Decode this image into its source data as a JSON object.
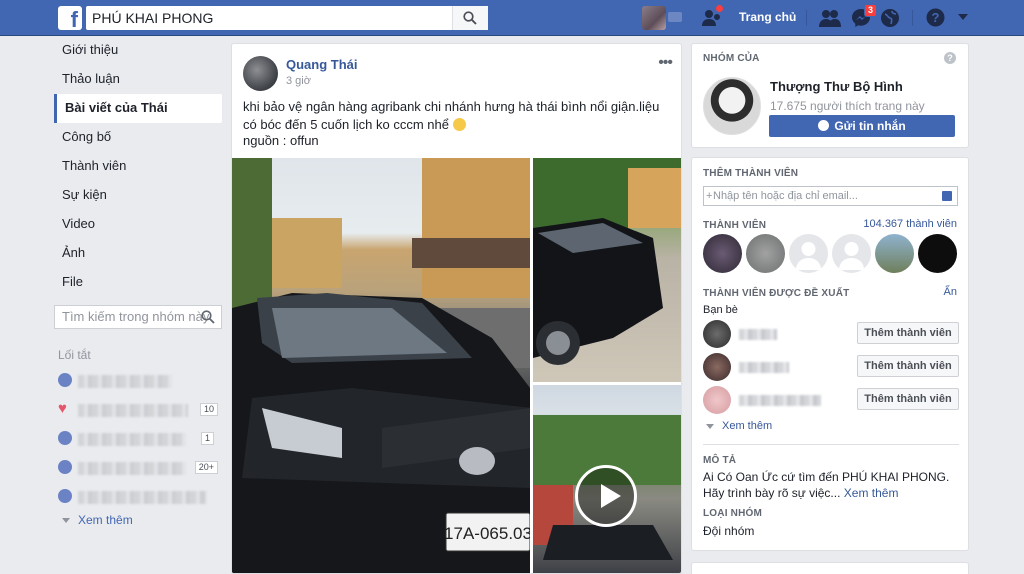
{
  "topbar": {
    "search_value": "PHÚ KHAI PHONG",
    "home_label": "Trang chủ",
    "messages_badge": "3",
    "colors": {
      "bar": "#4267b2"
    }
  },
  "left_nav": {
    "items": [
      {
        "label": "Giới thiệu"
      },
      {
        "label": "Thảo luận"
      },
      {
        "label": "Bài viết của Thái"
      },
      {
        "label": "Công bố"
      },
      {
        "label": "Thành viên"
      },
      {
        "label": "Sự kiện"
      },
      {
        "label": "Video"
      },
      {
        "label": "Ảnh"
      },
      {
        "label": "File"
      }
    ],
    "search_placeholder": "Tìm kiếm trong nhóm này",
    "shortcuts_title": "Lối tắt",
    "shortcut_counts": [
      "10",
      "1",
      "20+"
    ],
    "see_more": "Xem thêm"
  },
  "post": {
    "author": "Quang Thái",
    "time": "3 giờ",
    "text": "khi bảo vệ ngân hàng agribank chi nhánh hưng hà thái bình nổi giận.liệu có bóc đến 5 cuốn lịch ko cccm nhể",
    "source": "nguồn : offun",
    "plate_text": "17A-065.03"
  },
  "right": {
    "group_of": {
      "heading": "NHÓM CỦA",
      "page_name": "Thượng Thư Bộ Hình",
      "likes": "17.675 người thích trang này",
      "message_button": "Gửi tin nhắn"
    },
    "add_member": {
      "heading": "THÊM THÀNH VIÊN",
      "placeholder": "Nhập tên hoặc địa chỉ email...",
      "members_heading": "THÀNH VIÊN",
      "members_count": "104.367 thành viên",
      "suggested_heading": "THÀNH VIÊN ĐƯỢC ĐỀ XUẤT",
      "hide_label": "Ẩn",
      "friends_label": "Bạn bè",
      "add_button": "Thêm thành viên",
      "see_more": "Xem thêm",
      "desc_heading": "MÔ TẢ",
      "desc_text": "Ai Có Oan Ức cứ tìm đến PHÚ KHAI PHONG. Hãy trình bày rõ sự việc...",
      "desc_more": "Xem thêm",
      "type_heading": "LOẠI NHÓM",
      "type_value": "Đội nhóm"
    }
  }
}
